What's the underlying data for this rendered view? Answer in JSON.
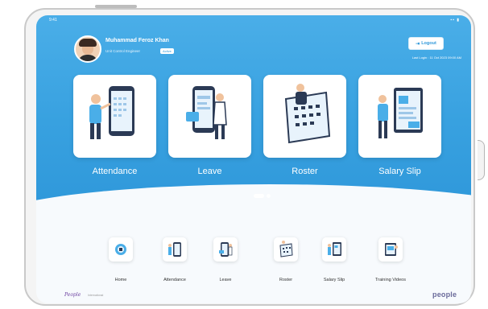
{
  "status_bar": {
    "time": "9:41",
    "icons": "▪▪ ▮"
  },
  "user": {
    "name": "Muhammad Feroz Khan",
    "role": "Unit Control Engineer",
    "badge": "Active"
  },
  "header": {
    "logout_label": "Logout",
    "logout_icon": "logout-icon",
    "last_login": "Last Login : 11 Oct 2023 09:00 AM"
  },
  "cards": [
    {
      "label": "Attendance",
      "icon": "attendance-illustration"
    },
    {
      "label": "Leave",
      "icon": "leave-illustration"
    },
    {
      "label": "Roster",
      "icon": "roster-illustration"
    },
    {
      "label": "Salary Slip",
      "icon": "salary-slip-illustration"
    }
  ],
  "carousel": {
    "pages": 2,
    "active": 1
  },
  "bottom_nav": [
    {
      "label": "Home",
      "icon": "home-icon"
    },
    {
      "label": "Attendance",
      "icon": "attendance-icon"
    },
    {
      "label": "Leave",
      "icon": "leave-icon"
    },
    {
      "label": "Roster",
      "icon": "roster-icon"
    },
    {
      "label": "Salary Slip",
      "icon": "salary-slip-icon"
    },
    {
      "label": "Training Videos",
      "icon": "training-videos-icon"
    }
  ],
  "branding": {
    "left_logo": "People",
    "left_sub": "International",
    "right_logo": "people"
  },
  "colors": {
    "primary": "#38a1e0",
    "white": "#ffffff",
    "accent_purple": "#6b3fa0"
  }
}
